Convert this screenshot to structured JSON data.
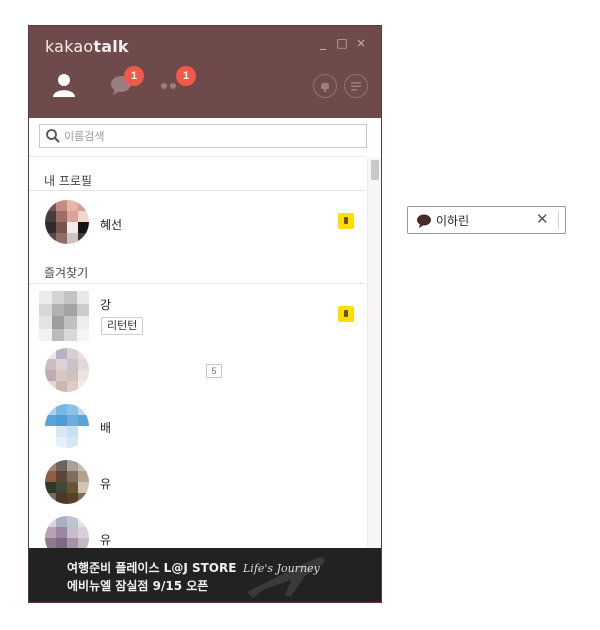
{
  "app": {
    "title_regular": "kakao",
    "title_bold": "talk",
    "window_controls": [
      "_",
      "□",
      "×"
    ]
  },
  "nav": {
    "chats_badge": "1",
    "more_badge": "1"
  },
  "search": {
    "placeholder": "이름검색"
  },
  "sections": {
    "my_profile": "내 프로필",
    "favorites": "즐겨찾기"
  },
  "my_profile": {
    "name": "혜선"
  },
  "favorites": [
    {
      "name": "강",
      "status": "리턴턴"
    },
    {
      "name": "",
      "count": "5"
    },
    {
      "name": "배"
    },
    {
      "name": "유"
    },
    {
      "name": "유"
    }
  ],
  "ad": {
    "line1": "여행준비 플레이스 L@J STORE",
    "line2": "에비뉴엘 잠실점 9/15 오픈",
    "logo": "Life's Journey"
  },
  "floating_chat": {
    "name": "이하린",
    "close": "✕"
  },
  "colors": {
    "titlebar": "#6e4a4b",
    "badge": "#f05a4a",
    "music_icon": "#f9e000",
    "ad_background": "#222222"
  }
}
